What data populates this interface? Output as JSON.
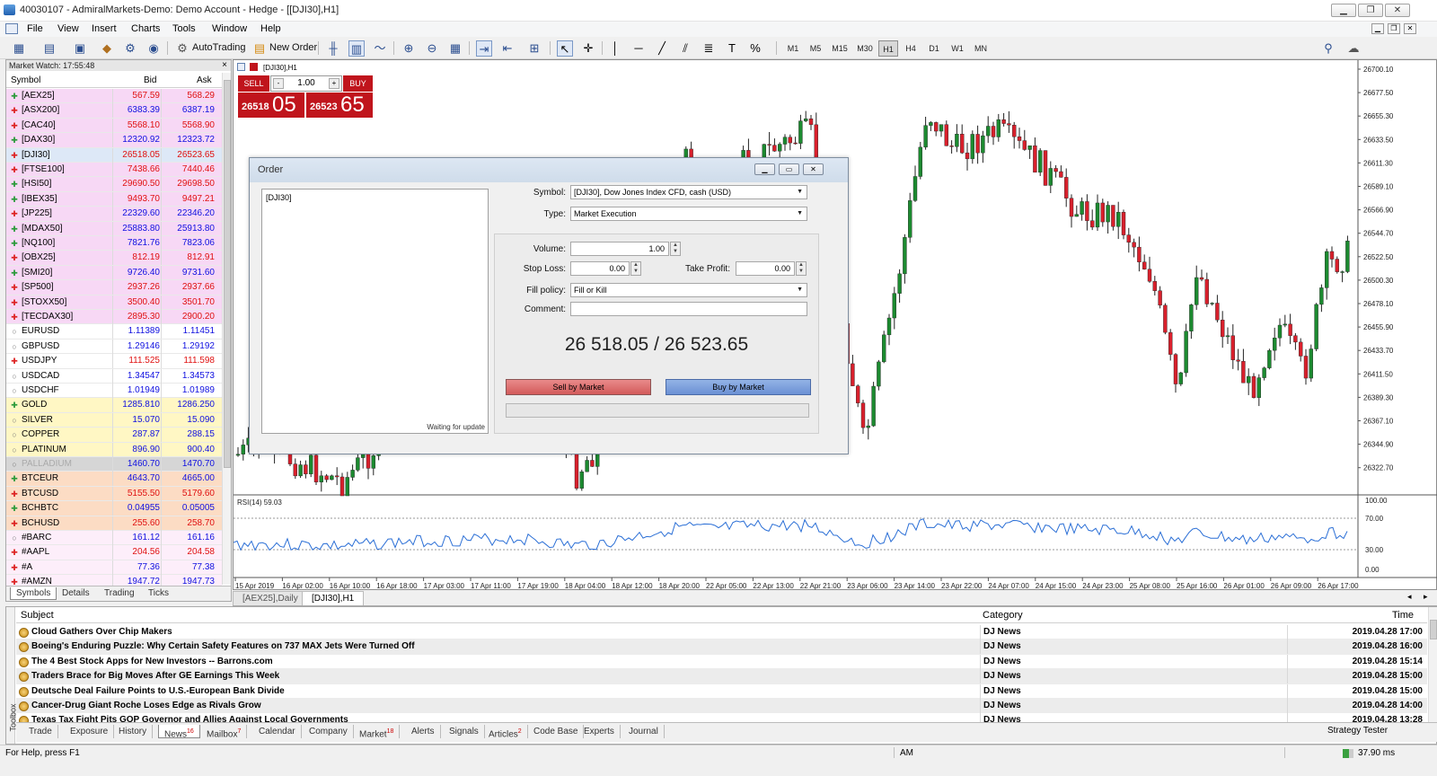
{
  "window": {
    "title": "40030107 - AdmiralMarkets-Demo: Demo Account - Hedge - [[DJI30],H1]",
    "min": "▁",
    "restore": "❐",
    "close": "✕"
  },
  "menu": [
    "File",
    "View",
    "Insert",
    "Charts",
    "Tools",
    "Window",
    "Help"
  ],
  "toolbar": {
    "autotrading": "AutoTrading",
    "new_order": "New Order",
    "timeframes": [
      "M1",
      "M5",
      "M15",
      "M30",
      "H1",
      "H4",
      "D1",
      "W1",
      "MN"
    ],
    "active_timeframe": "H1"
  },
  "market_watch": {
    "title": "Market Watch: 17:55:48",
    "close": "×",
    "col_symbol": "Symbol",
    "col_bid": "Bid",
    "col_ask": "Ask",
    "rows": [
      {
        "sym": "[AEX25]",
        "bid": "567.59",
        "ask": "568.29",
        "bg": "#f7d8f5",
        "dir": "up",
        "bc": "#e01010",
        "ac": "#e01010"
      },
      {
        "sym": "[ASX200]",
        "bid": "6383.39",
        "ask": "6387.19",
        "bg": "#f7d8f5",
        "dir": "down",
        "bc": "#1010e0",
        "ac": "#1010e0"
      },
      {
        "sym": "[CAC40]",
        "bid": "5568.10",
        "ask": "5568.90",
        "bg": "#f7d8f5",
        "dir": "down",
        "bc": "#e01010",
        "ac": "#e01010"
      },
      {
        "sym": "[DAX30]",
        "bid": "12320.92",
        "ask": "12323.72",
        "bg": "#f7d8f5",
        "dir": "up",
        "bc": "#1010e0",
        "ac": "#1010e0"
      },
      {
        "sym": "[DJI30]",
        "bid": "26518.05",
        "ask": "26523.65",
        "bg": "#dde8f7",
        "dir": "down",
        "bc": "#e01010",
        "ac": "#e01010"
      },
      {
        "sym": "[FTSE100]",
        "bid": "7438.66",
        "ask": "7440.46",
        "bg": "#f7d8f5",
        "dir": "down",
        "bc": "#e01010",
        "ac": "#e01010"
      },
      {
        "sym": "[HSI50]",
        "bid": "29690.50",
        "ask": "29698.50",
        "bg": "#f7d8f5",
        "dir": "up",
        "bc": "#e01010",
        "ac": "#e01010"
      },
      {
        "sym": "[IBEX35]",
        "bid": "9493.70",
        "ask": "9497.21",
        "bg": "#f7d8f5",
        "dir": "up",
        "bc": "#e01010",
        "ac": "#e01010"
      },
      {
        "sym": "[JP225]",
        "bid": "22329.60",
        "ask": "22346.20",
        "bg": "#f7d8f5",
        "dir": "down",
        "bc": "#1010e0",
        "ac": "#1010e0"
      },
      {
        "sym": "[MDAX50]",
        "bid": "25883.80",
        "ask": "25913.80",
        "bg": "#f7d8f5",
        "dir": "up",
        "bc": "#1010e0",
        "ac": "#1010e0"
      },
      {
        "sym": "[NQ100]",
        "bid": "7821.76",
        "ask": "7823.06",
        "bg": "#f7d8f5",
        "dir": "up",
        "bc": "#1010e0",
        "ac": "#1010e0"
      },
      {
        "sym": "[OBX25]",
        "bid": "812.19",
        "ask": "812.91",
        "bg": "#f7d8f5",
        "dir": "down",
        "bc": "#e01010",
        "ac": "#e01010"
      },
      {
        "sym": "[SMI20]",
        "bid": "9726.40",
        "ask": "9731.60",
        "bg": "#f7d8f5",
        "dir": "up",
        "bc": "#1010e0",
        "ac": "#1010e0"
      },
      {
        "sym": "[SP500]",
        "bid": "2937.26",
        "ask": "2937.66",
        "bg": "#f7d8f5",
        "dir": "down",
        "bc": "#e01010",
        "ac": "#e01010"
      },
      {
        "sym": "[STOXX50]",
        "bid": "3500.40",
        "ask": "3501.70",
        "bg": "#f7d8f5",
        "dir": "down",
        "bc": "#e01010",
        "ac": "#e01010"
      },
      {
        "sym": "[TECDAX30]",
        "bid": "2895.30",
        "ask": "2900.20",
        "bg": "#f7d8f5",
        "dir": "down",
        "bc": "#e01010",
        "ac": "#e01010"
      },
      {
        "sym": "EURUSD",
        "bid": "1.11389",
        "ask": "1.11451",
        "bg": "#ffffff",
        "dir": "none",
        "bc": "#1010e0",
        "ac": "#1010e0"
      },
      {
        "sym": "GBPUSD",
        "bid": "1.29146",
        "ask": "1.29192",
        "bg": "#ffffff",
        "dir": "none",
        "bc": "#1010e0",
        "ac": "#1010e0"
      },
      {
        "sym": "USDJPY",
        "bid": "111.525",
        "ask": "111.598",
        "bg": "#ffffff",
        "dir": "down",
        "bc": "#e01010",
        "ac": "#e01010"
      },
      {
        "sym": "USDCAD",
        "bid": "1.34547",
        "ask": "1.34573",
        "bg": "#ffffff",
        "dir": "none",
        "bc": "#1010e0",
        "ac": "#1010e0"
      },
      {
        "sym": "USDCHF",
        "bid": "1.01949",
        "ask": "1.01989",
        "bg": "#ffffff",
        "dir": "none",
        "bc": "#1010e0",
        "ac": "#1010e0"
      },
      {
        "sym": "GOLD",
        "bid": "1285.810",
        "ask": "1286.250",
        "bg": "#fff7c4",
        "dir": "up",
        "bc": "#1010e0",
        "ac": "#1010e0"
      },
      {
        "sym": "SILVER",
        "bid": "15.070",
        "ask": "15.090",
        "bg": "#fff7c4",
        "dir": "none",
        "bc": "#1010e0",
        "ac": "#1010e0"
      },
      {
        "sym": "COPPER",
        "bid": "287.87",
        "ask": "288.15",
        "bg": "#fff7c4",
        "dir": "none",
        "bc": "#1010e0",
        "ac": "#1010e0"
      },
      {
        "sym": "PLATINUM",
        "bid": "896.90",
        "ask": "900.40",
        "bg": "#fff7c4",
        "dir": "none",
        "bc": "#1010e0",
        "ac": "#1010e0"
      },
      {
        "sym": "PALLADIUM",
        "bid": "1460.70",
        "ask": "1470.70",
        "bg": "#d6d6d6",
        "dir": "none",
        "bc": "#1010e0",
        "ac": "#1010e0",
        "dim": true
      },
      {
        "sym": "BTCEUR",
        "bid": "4643.70",
        "ask": "4665.00",
        "bg": "#fcdcc4",
        "dir": "up",
        "bc": "#1010e0",
        "ac": "#1010e0"
      },
      {
        "sym": "BTCUSD",
        "bid": "5155.50",
        "ask": "5179.60",
        "bg": "#fcdcc4",
        "dir": "down",
        "bc": "#e01010",
        "ac": "#e01010"
      },
      {
        "sym": "BCHBTC",
        "bid": "0.04955",
        "ask": "0.05005",
        "bg": "#fcdcc4",
        "dir": "up",
        "bc": "#1010e0",
        "ac": "#1010e0"
      },
      {
        "sym": "BCHUSD",
        "bid": "255.60",
        "ask": "258.70",
        "bg": "#fcdcc4",
        "dir": "down",
        "bc": "#e01010",
        "ac": "#e01010"
      },
      {
        "sym": "#BARC",
        "bid": "161.12",
        "ask": "161.16",
        "bg": "#fdeefa",
        "dir": "none",
        "bc": "#1010e0",
        "ac": "#1010e0"
      },
      {
        "sym": "#AAPL",
        "bid": "204.56",
        "ask": "204.58",
        "bg": "#fdeefa",
        "dir": "down",
        "bc": "#e01010",
        "ac": "#e01010"
      },
      {
        "sym": "#A",
        "bid": "77.36",
        "ask": "77.38",
        "bg": "#fdeefa",
        "dir": "down",
        "bc": "#1010e0",
        "ac": "#1010e0"
      },
      {
        "sym": "#AMZN",
        "bid": "1947.72",
        "ask": "1947.73",
        "bg": "#fdeefa",
        "dir": "down",
        "bc": "#1010e0",
        "ac": "#1010e0"
      }
    ],
    "tabs": [
      "Symbols",
      "Details",
      "Trading",
      "Ticks"
    ]
  },
  "chart": {
    "label": "[DJI30],H1",
    "trade": {
      "sell": "SELL",
      "buy": "BUY",
      "volume": "1.00",
      "sell_small": "26518",
      "sell_big": "05",
      "buy_small": "26523",
      "buy_big": "65"
    },
    "price_axis": [
      "26700.10",
      "26677.50",
      "26655.30",
      "26633.50",
      "26611.30",
      "26589.10",
      "26566.90",
      "26544.70",
      "26522.50",
      "26500.30",
      "26478.10",
      "26455.90",
      "26433.70",
      "26411.50",
      "26389.30",
      "26367.10",
      "26344.90",
      "26322.70"
    ],
    "rsi_label": "RSI(14) 59.03",
    "rsi_axis": [
      "100.00",
      "70.00",
      "30.00",
      "0.00"
    ],
    "time_axis": [
      "15 Apr 2019",
      "16 Apr 02:00",
      "16 Apr 10:00",
      "16 Apr 18:00",
      "17 Apr 03:00",
      "17 Apr 11:00",
      "17 Apr 19:00",
      "18 Apr 04:00",
      "18 Apr 12:00",
      "18 Apr 20:00",
      "22 Apr 05:00",
      "22 Apr 13:00",
      "22 Apr 21:00",
      "23 Apr 06:00",
      "23 Apr 14:00",
      "23 Apr 22:00",
      "24 Apr 07:00",
      "24 Apr 15:00",
      "24 Apr 23:00",
      "25 Apr 08:00",
      "25 Apr 16:00",
      "26 Apr 01:00",
      "26 Apr 09:00",
      "26 Apr 17:00"
    ],
    "up_color": "#1c8a30",
    "down_color": "#d8202c"
  },
  "chart_tabs": [
    "[AEX25],Daily",
    "[DJI30],H1"
  ],
  "order": {
    "title": "Order",
    "tick_symbol": "[DJI30]",
    "waiting": "Waiting for update",
    "symbol_label": "Symbol:",
    "symbol_value": "[DJI30], Dow Jones Index CFD, cash (USD)",
    "type_label": "Type:",
    "type_value": "Market Execution",
    "volume_label": "Volume:",
    "volume_value": "1.00",
    "sl_label": "Stop Loss:",
    "sl_value": "0.00",
    "tp_label": "Take Profit:",
    "tp_value": "0.00",
    "fill_label": "Fill policy:",
    "fill_value": "Fill or Kill",
    "comment_label": "Comment:",
    "comment_value": "",
    "price": "26 518.05 / 26 523.65",
    "sell_btn": "Sell by Market",
    "buy_btn": "Buy by Market"
  },
  "news": {
    "col_subject": "Subject",
    "col_category": "Category",
    "col_time": "Time",
    "rows": [
      {
        "subject": "Cloud Gathers Over Chip Makers",
        "category": "DJ News",
        "time": "2019.04.28 17:00"
      },
      {
        "subject": "Boeing's Enduring Puzzle: Why Certain Safety Features on 737 MAX Jets Were Turned Off",
        "category": "DJ News",
        "time": "2019.04.28 16:00"
      },
      {
        "subject": "The 4 Best Stock Apps for New Investors -- Barrons.com",
        "category": "DJ News",
        "time": "2019.04.28 15:14"
      },
      {
        "subject": "Traders Brace for Big Moves After GE Earnings This Week",
        "category": "DJ News",
        "time": "2019.04.28 15:00"
      },
      {
        "subject": "Deutsche Deal Failure Points to U.S.-European Bank Divide",
        "category": "DJ News",
        "time": "2019.04.28 15:00"
      },
      {
        "subject": "Cancer-Drug Giant Roche Loses Edge as Rivals Grow",
        "category": "DJ News",
        "time": "2019.04.28 14:00"
      },
      {
        "subject": "Texas Tax Fight Pits GOP Governor and Allies Against Local Governments",
        "category": "DJ News",
        "time": "2019.04.28 13:28"
      }
    ],
    "side_label": "Toolbox",
    "tabs": [
      {
        "l": "Trade",
        "c": ""
      },
      {
        "l": "Exposure",
        "c": ""
      },
      {
        "l": "History",
        "c": ""
      },
      {
        "l": "News",
        "c": "16"
      },
      {
        "l": "Mailbox",
        "c": "7"
      },
      {
        "l": "Calendar",
        "c": ""
      },
      {
        "l": "Company",
        "c": ""
      },
      {
        "l": "Market",
        "c": "18"
      },
      {
        "l": "Alerts",
        "c": ""
      },
      {
        "l": "Signals",
        "c": ""
      },
      {
        "l": "Articles",
        "c": "2"
      },
      {
        "l": "Code Base",
        "c": ""
      },
      {
        "l": "Experts",
        "c": ""
      },
      {
        "l": "Journal",
        "c": ""
      }
    ],
    "strategy_tester": "Strategy Tester"
  },
  "status": {
    "help": "For Help, press F1",
    "am": "AM",
    "ping": "37.90 ms"
  }
}
